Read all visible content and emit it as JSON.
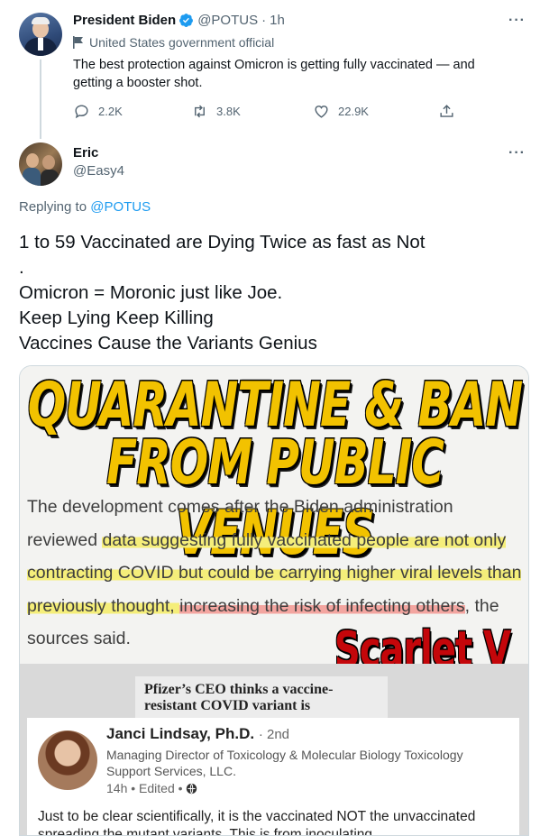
{
  "original_tweet": {
    "author_name": "President Biden",
    "handle": "@POTUS",
    "time": "1h",
    "label": "United States government official",
    "text": "The best protection against Omicron is getting fully vaccinated — and getting a booster shot.",
    "reply_count": "2.2K",
    "retweet_count": "3.8K",
    "like_count": "22.9K"
  },
  "reply_tweet": {
    "author_name": "Eric",
    "handle": "@Easy4",
    "replying_prefix": "Replying to",
    "replying_handle": "@POTUS",
    "text": "1 to 59 Vaccinated are Dying Twice as fast as Not\n.\nOmicron = Moronic just like Joe.\nKeep Lying Keep Killing\nVaccines Cause the Variants Genius"
  },
  "media": {
    "headline_line1": "QUARANTINE & BAN",
    "headline_line2": "FROM PUBLIC VENUES",
    "article_seg1": "The development comes after the Biden administration reviewed ",
    "article_seg2": "data suggesting fully vaccinated people are not only ",
    "article_seg3": "contracting COVID but could be carrying higher viral levels than previously thought, ",
    "article_seg4": "increasing the risk of infecting others",
    "article_seg5": ", the sources said.",
    "overlay_text": "Scarlet V",
    "pfizer_headline": "Pfizer’s CEO thinks a vaccine-resistant COVID variant is",
    "linkedin_name": "Janci Lindsay, Ph.D.",
    "linkedin_degree": "· 2nd",
    "linkedin_title": "Managing Director of Toxicology & Molecular Biology Toxicology Support Services, LLC.",
    "linkedin_meta": "14h • Edited • ",
    "linkedin_post": "Just to be clear scientifically,  it is the vaccinated NOT the unvaccinated spreading the mutant variants. This is from inoculating"
  },
  "colors": {
    "accent": "#1d9bf0",
    "headline_yellow": "#f2c200",
    "scarlet_red": "#c4060a"
  },
  "icons": [
    "verified-badge-icon",
    "flag-icon",
    "reply-icon",
    "retweet-icon",
    "like-icon",
    "share-icon",
    "more-icon",
    "globe-icon"
  ]
}
